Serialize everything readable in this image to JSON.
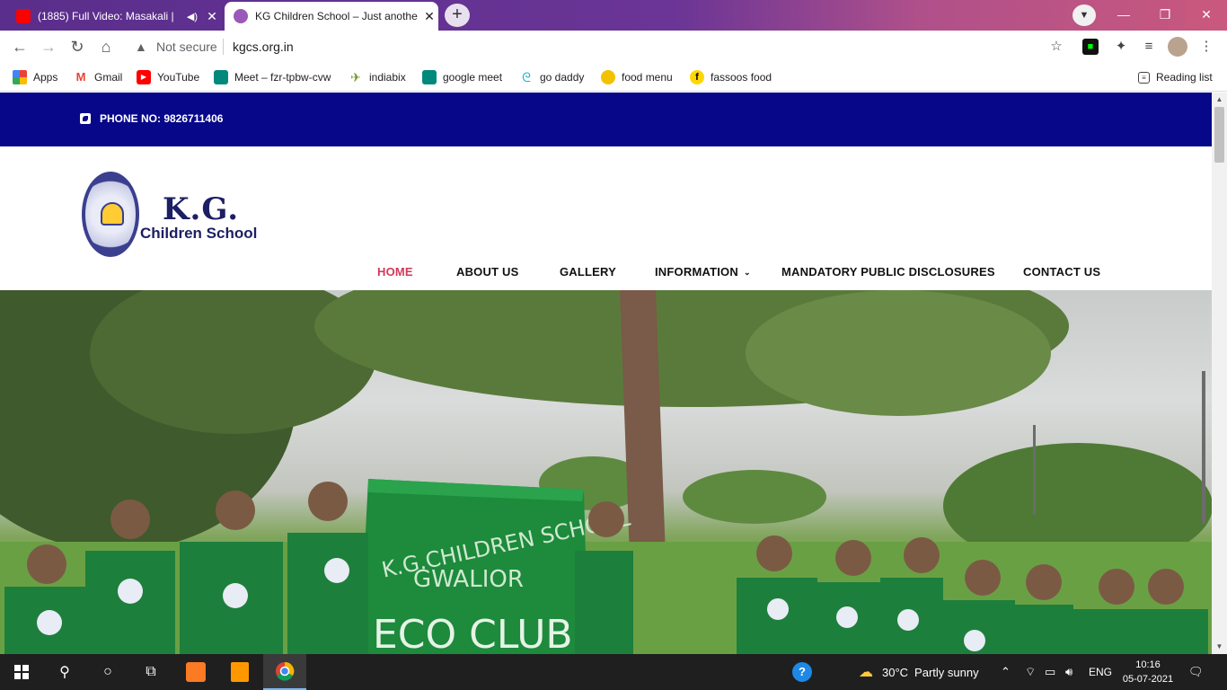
{
  "browser": {
    "tabs": [
      {
        "title": "(1885) Full Video: Masakali |",
        "favicon": "youtube-icon",
        "active": false
      },
      {
        "title": "KG Children School – Just anothe",
        "favicon": "kgcs-icon",
        "active": true
      }
    ],
    "address": {
      "security": "Not secure",
      "url": "kgcs.org.in"
    },
    "bookmarks": [
      {
        "label": "Apps",
        "icon": "apps-grid-icon"
      },
      {
        "label": "Gmail",
        "icon": "gmail-icon"
      },
      {
        "label": "YouTube",
        "icon": "youtube-icon"
      },
      {
        "label": "Meet – fzr-tpbw-cvw",
        "icon": "meet-icon"
      },
      {
        "label": "indiabix",
        "icon": "indiabix-icon"
      },
      {
        "label": "google meet",
        "icon": "meet-icon"
      },
      {
        "label": "go daddy",
        "icon": "godaddy-icon"
      },
      {
        "label": "food menu",
        "icon": "food-icon"
      },
      {
        "label": "fassoos food",
        "icon": "faasos-icon"
      }
    ],
    "reading_list": "Reading list"
  },
  "site": {
    "phone_label": "PHONE NO: 9826711406",
    "logo": {
      "line1": "K.G.",
      "line2": "Children School",
      "seal_text": "K.G. CHILDREN SCHOOL"
    },
    "menu": [
      {
        "label": "HOME",
        "active": true
      },
      {
        "label": "ABOUT US"
      },
      {
        "label": "GALLERY"
      },
      {
        "label": "INFORMATION",
        "has_dropdown": true
      },
      {
        "label": "MANDATORY PUBLIC DISCLOSURES"
      },
      {
        "label": "CONTACT US"
      }
    ],
    "accent_color": "#d1395a",
    "topbar_color": "#07078a",
    "hero": {
      "banner_line1": "K.G.CHILDREN SCHOOL",
      "banner_line2": "GWALIOR",
      "banner_line3": "ECO CLUB"
    }
  },
  "taskbar": {
    "weather": {
      "temp": "30°C",
      "condition": "Partly sunny"
    },
    "language": "ENG",
    "time": "10:16",
    "date": "05-07-2021"
  }
}
